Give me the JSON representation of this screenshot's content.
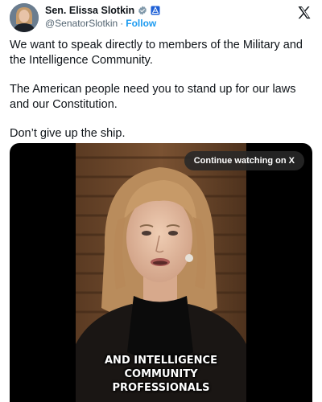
{
  "author": {
    "display_name": "Sen. Elissa Slotkin",
    "handle": "@SenatorSlotkin",
    "separator": "·",
    "follow_label": "Follow"
  },
  "colors": {
    "accent": "#1d9bf0",
    "text": "#0f1419",
    "muted": "#536471",
    "verified_badge": "#829aab",
    "gov_badge": "#1d5fd6"
  },
  "tweet": {
    "paragraphs": [
      "We want to speak directly to members of the Military and the Intelligence Community.",
      "The American people need you to stand up for our laws and our Constitution.",
      "Don’t give up the ship."
    ]
  },
  "video": {
    "continue_label": "Continue watching on X",
    "caption_lines": [
      "AND INTELLIGENCE",
      "COMMUNITY",
      "PROFESSIONALS"
    ]
  },
  "icons": {
    "verified": "verified-badge-icon",
    "government": "government-badge-icon",
    "logo": "x-logo-icon"
  }
}
